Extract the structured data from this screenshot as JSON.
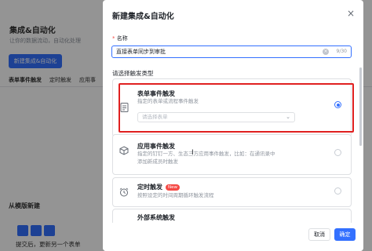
{
  "background": {
    "title": "集成&自动化",
    "description": "让你的数据流动，自动化处理",
    "new_button": "新建集成&自动化",
    "tabs": [
      "表单事件触发",
      "定时触发",
      "应用事"
    ],
    "template_heading": "从模版新建",
    "bottom_text": "提交后，更新另一个表单"
  },
  "modal": {
    "title": "新建集成&自动化",
    "close": "×",
    "name_label": "名称",
    "required_mark": "*",
    "name_value": "直接表单同步到审批",
    "name_count": "9/30",
    "type_label": "请选择触发类型",
    "cards": [
      {
        "title": "表单事件触发",
        "desc": [
          "指定的表单或流程事件触发"
        ],
        "icon": "document-icon",
        "selected": true,
        "select_placeholder": "请选择表单"
      },
      {
        "title": "应用事件触发",
        "desc": [
          "指定的钉钉一方、生态三方应用事件触发，比如：在通讯录中",
          "添加新成员时触发"
        ],
        "icon": "cube-icon",
        "selected": false
      },
      {
        "title": "定时触发",
        "badge": "New",
        "desc": [
          "按照设定的时间周期循环触发流程"
        ],
        "icon": "alarm-clock-icon",
        "selected": false
      },
      {
        "title": "外部系统触发",
        "desc": [
          ""
        ],
        "icon": "link-icon",
        "selected": false
      }
    ],
    "cancel": "取消",
    "confirm": "确定"
  },
  "colors": {
    "accent": "#3370ff",
    "highlight": "#e02020"
  }
}
